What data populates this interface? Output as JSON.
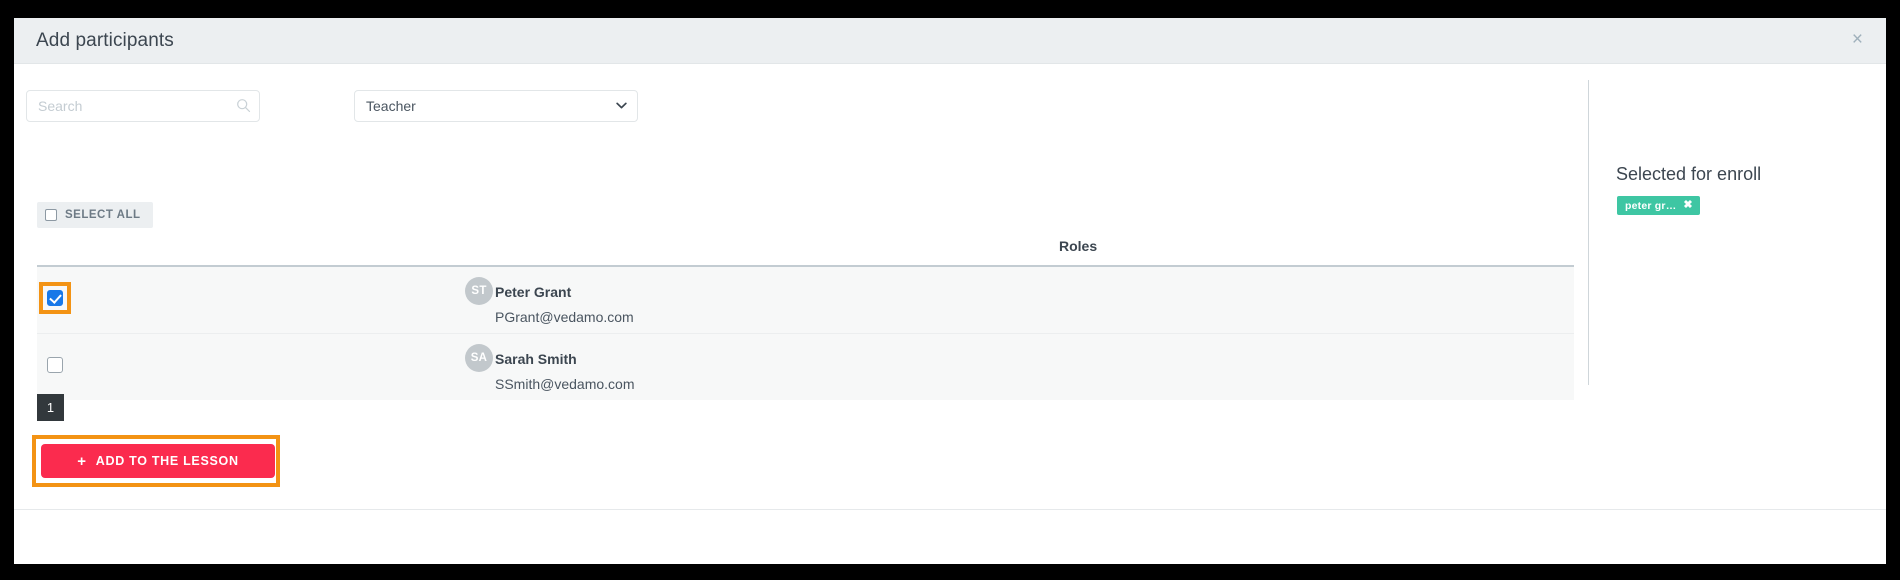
{
  "modal": {
    "title": "Add participants",
    "close_label": "×"
  },
  "filters": {
    "search": {
      "placeholder": "Search",
      "value": "",
      "icon": "search-icon"
    },
    "role_select": {
      "selected": "Teacher",
      "options": [
        "Teacher"
      ],
      "icon": "chevron-down-icon"
    }
  },
  "select_all": {
    "label": "SELECT ALL",
    "checked": false
  },
  "table": {
    "columns": [
      "",
      "",
      "Roles"
    ],
    "roles_header": "Roles",
    "rows": [
      {
        "checked": true,
        "initials": "ST",
        "name": "Peter Grant",
        "email": "PGrant@vedamo.com",
        "roles": ""
      },
      {
        "checked": false,
        "initials": "SA",
        "name": "Sarah Smith",
        "email": "SSmith@vedamo.com",
        "roles": ""
      }
    ]
  },
  "pagination": {
    "pages": [
      "1"
    ],
    "current": "1"
  },
  "selected_panel": {
    "title": "Selected for enroll",
    "chips": [
      {
        "label": "peter gr…",
        "remove_label": "✖"
      }
    ]
  },
  "action": {
    "add_label": "ADD TO THE LESSON",
    "plus_glyph": "+"
  },
  "colors": {
    "accent_red": "#fb2b4e",
    "chip_teal": "#3ec6a3",
    "checkbox_blue": "#1878e8",
    "annotation_orange": "#f39314",
    "header_bg": "#eceff1",
    "row_bg": "#f7f8f8",
    "pagination_dark": "#32383c"
  }
}
